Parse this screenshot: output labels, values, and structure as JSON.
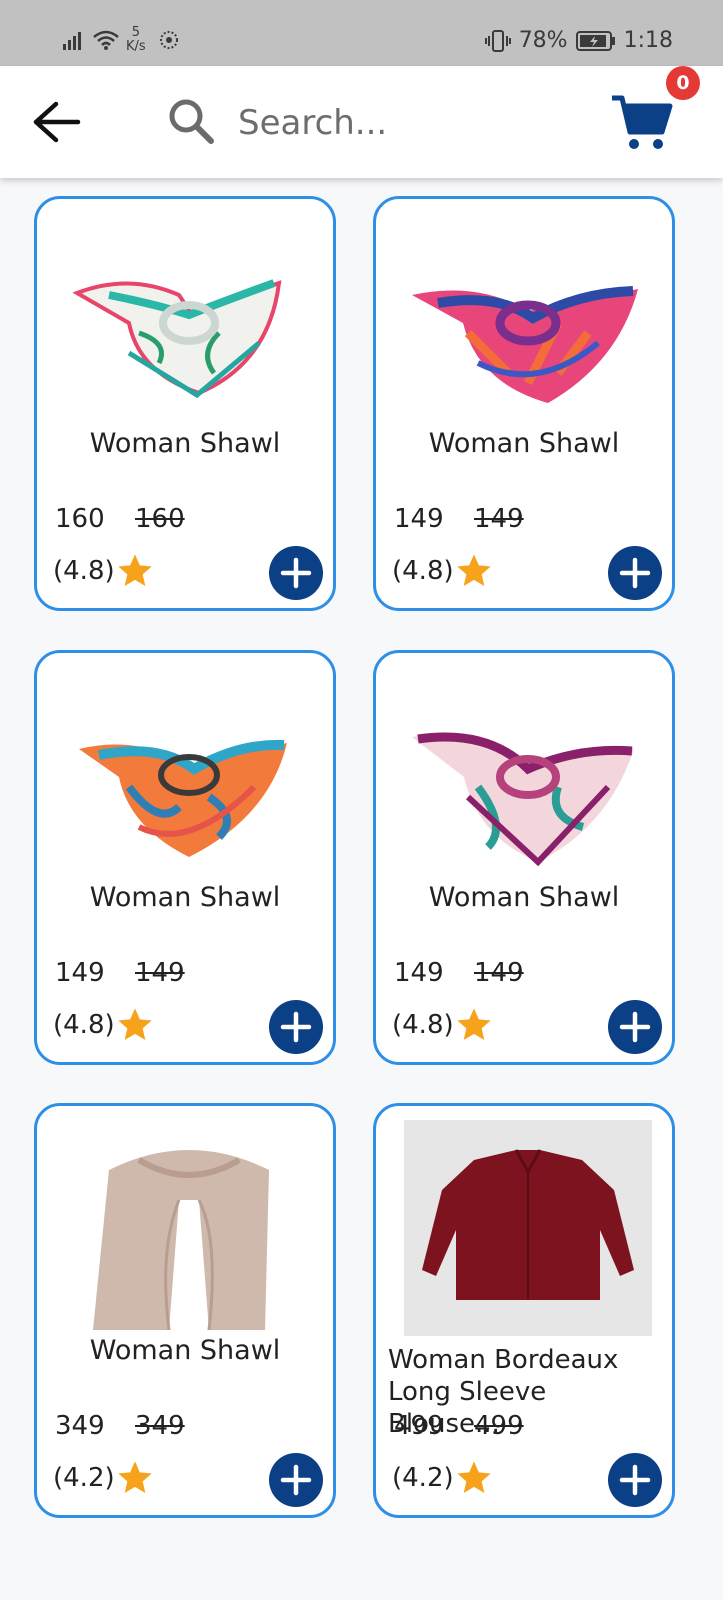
{
  "status_bar": {
    "net_speed_value": "5",
    "net_speed_unit": "K/s",
    "battery": "78%",
    "time": "1:18"
  },
  "header": {
    "search_placeholder": "Search...",
    "cart_count": "0"
  },
  "colors": {
    "accent_blue": "#2e8fe6",
    "button_navy": "#0b3f86",
    "star": "#f7a21b",
    "badge_red": "#e53935"
  },
  "products": [
    {
      "title": "Woman Shawl",
      "price": "160",
      "old_price": "160",
      "rating": "(4.8)"
    },
    {
      "title": "Woman Shawl",
      "price": "149",
      "old_price": "149",
      "rating": "(4.8)"
    },
    {
      "title": "Woman Shawl",
      "price": "149",
      "old_price": "149",
      "rating": "(4.8)"
    },
    {
      "title": "Woman Shawl",
      "price": "149",
      "old_price": "149",
      "rating": "(4.8)"
    },
    {
      "title": "Woman Shawl",
      "price": "349",
      "old_price": "349",
      "rating": "(4.2)"
    },
    {
      "title": "Woman Bordeaux Long Sleeve Blouse...",
      "price": "499",
      "old_price": "499",
      "rating": "(4.2)"
    }
  ]
}
